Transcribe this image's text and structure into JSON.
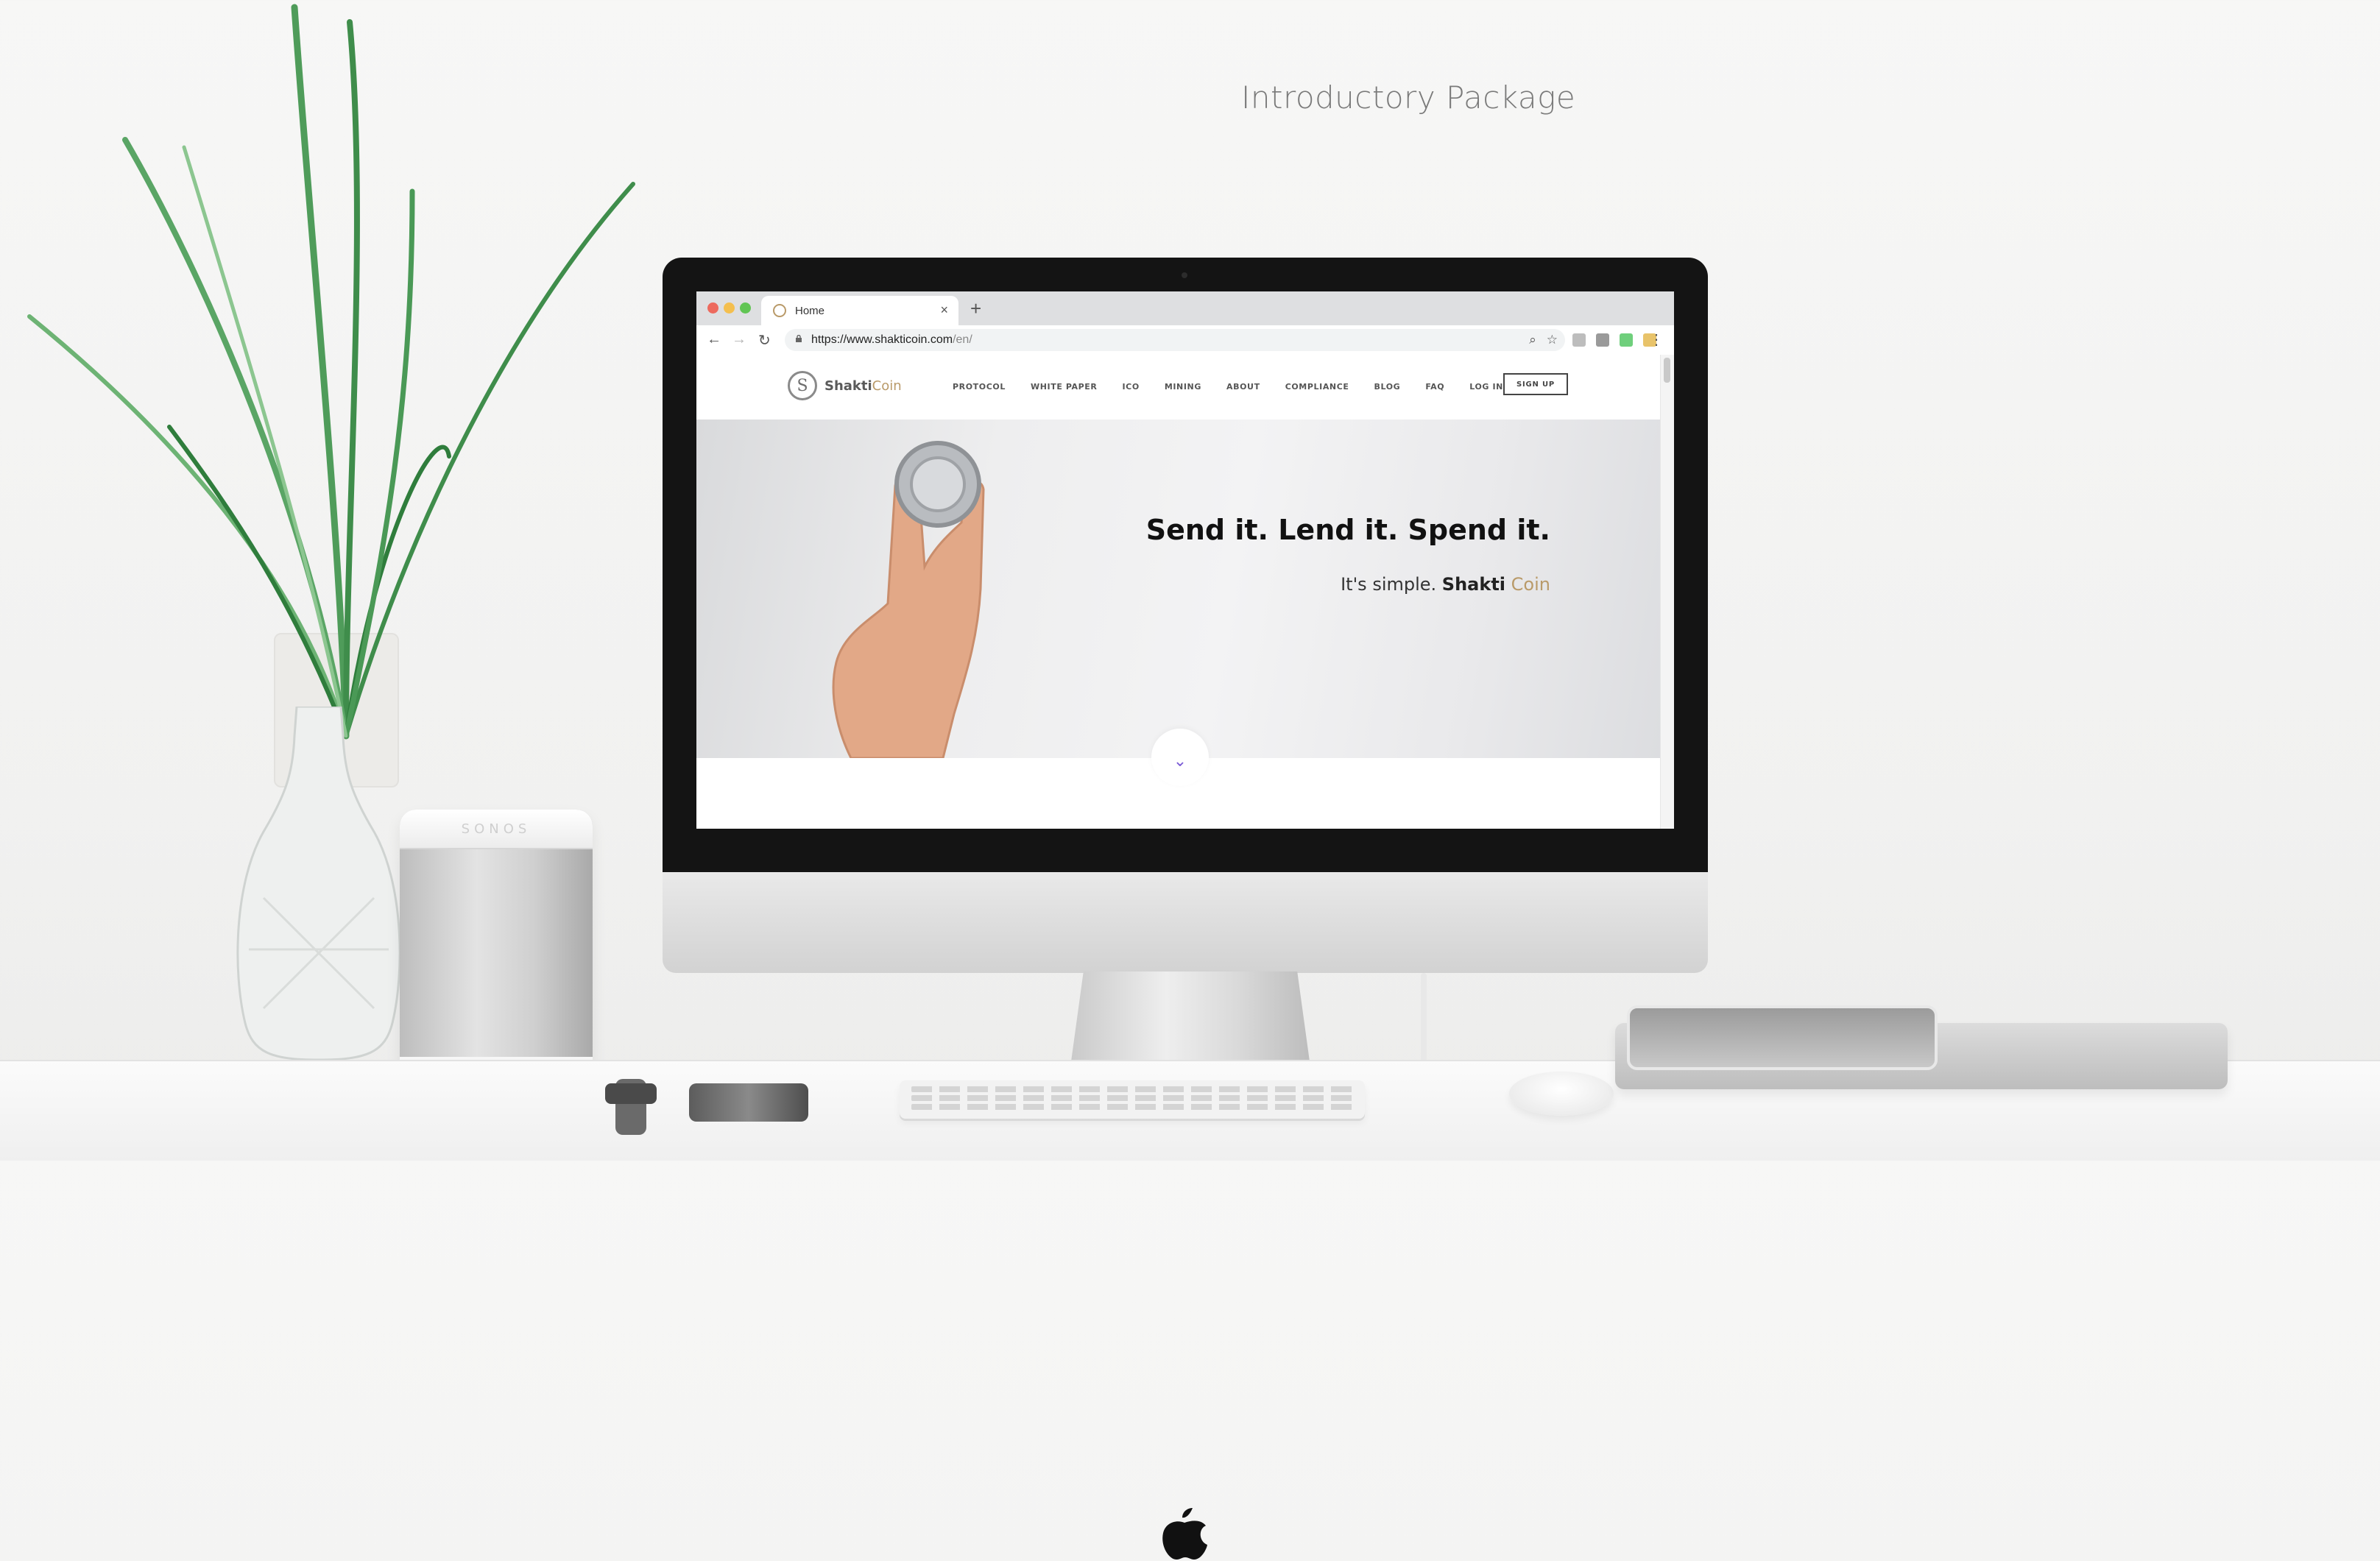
{
  "headline": "Introductory Package",
  "brand_colors": {
    "gold": "#b99a69",
    "accent": "#7b5cd6"
  },
  "speaker": {
    "brand": "SONOS"
  },
  "browser": {
    "tab_title": "Home",
    "tab_close": "×",
    "new_tab": "+",
    "url_host": "https://www.shakticoin.com",
    "url_path": "/en/",
    "back": "←",
    "forward": "→",
    "reload": "↻",
    "zoom_icon": "⌕",
    "star_icon": "☆",
    "menu": "⋮"
  },
  "site": {
    "logo_mark": "S",
    "logo_name": "Shakti",
    "logo_coin": "Coin",
    "nav": [
      "PROTOCOL",
      "WHITE PAPER",
      "ICO",
      "MINING",
      "ABOUT",
      "COMPLIANCE",
      "BLOG",
      "FAQ",
      "LOG IN"
    ],
    "signup": "SIGN UP",
    "hero_title": "Send it. Lend it. Spend it.",
    "hero_sub_prefix": "It's simple. ",
    "hero_sub_bold": "Shakti",
    "hero_sub_coin": "Coin",
    "scroll_down": "⌄"
  }
}
